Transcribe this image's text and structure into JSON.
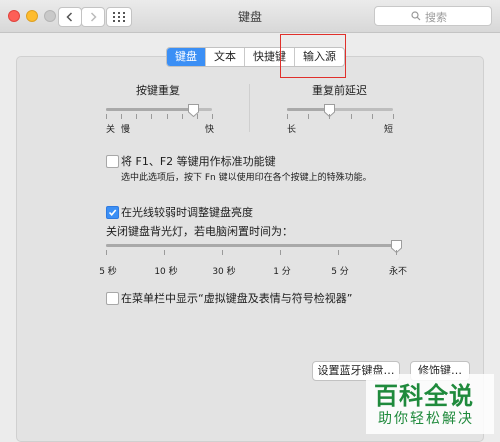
{
  "window": {
    "title": "键盘"
  },
  "search": {
    "placeholder": "搜索"
  },
  "tabs": [
    {
      "label": "键盘",
      "active": true
    },
    {
      "label": "文本",
      "active": false
    },
    {
      "label": "快捷键",
      "active": false
    },
    {
      "label": "输入源",
      "active": false
    }
  ],
  "key_repeat": {
    "title": "按键重复",
    "left_label": "关",
    "left_label2": "慢",
    "right_label": "快",
    "value_fraction": 0.83
  },
  "repeat_delay": {
    "title": "重复前延迟",
    "left_label": "长",
    "right_label": "短",
    "value_fraction": 0.4
  },
  "fn_option": {
    "label": "将 F1、F2 等键用作标准功能键",
    "description": "选中此选项后，按下 Fn 键以使用印在各个按键上的特殊功能。",
    "checked": false
  },
  "brightness_option": {
    "label": "在光线较弱时调整键盘亮度",
    "checked": true
  },
  "backlight": {
    "title": "关闭键盘背光灯，若电脑闲置时间为：",
    "ticks": [
      "5 秒",
      "10 秒",
      "30 秒",
      "1 分",
      "5 分",
      "永不"
    ],
    "value_index": 5
  },
  "viewer_option": {
    "label": "在菜单栏中显示“虚拟键盘及表情与符号检视器”",
    "checked": false
  },
  "buttons": {
    "bluetooth": "设置蓝牙键盘…",
    "modifier": "修饰键…"
  },
  "watermark": {
    "line1": "百科全说",
    "line2": "助你轻松解决"
  },
  "colors": {
    "accent": "#3b8ff5",
    "highlight_box": "#e0302b",
    "watermark": "#1f8a3c"
  }
}
